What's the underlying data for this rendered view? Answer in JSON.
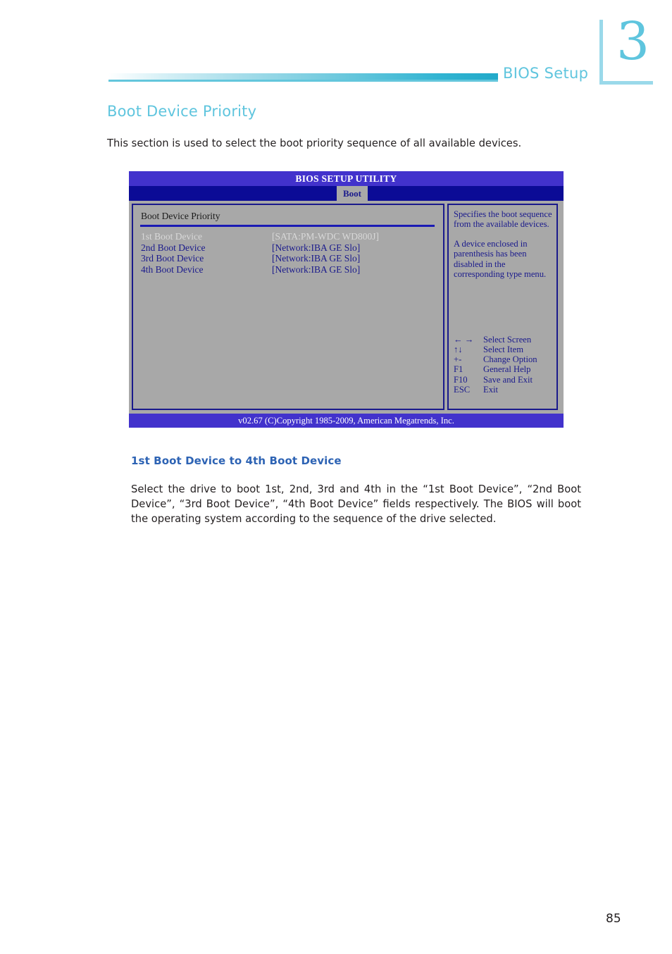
{
  "header": {
    "chapter_number": "3",
    "label": "BIOS Setup"
  },
  "section": {
    "heading": "Boot Device Priority",
    "intro": "This section is used to select the boot priority sequence of all available devices."
  },
  "bios": {
    "title": "BIOS SETUP UTILITY",
    "active_tab": "Boot",
    "panel_title": "Boot Device Priority",
    "devices": [
      {
        "label": "1st Boot Device",
        "value": "[SATA:PM-WDC WD800J]",
        "selected": true
      },
      {
        "label": "2nd Boot Device",
        "value": "[Network:IBA GE Slo]",
        "selected": false
      },
      {
        "label": "3rd Boot Device",
        "value": "[Network:IBA GE Slo]",
        "selected": false
      },
      {
        "label": "4th Boot Device",
        "value": "[Network:IBA GE Slo]",
        "selected": false
      }
    ],
    "help": {
      "paragraph1": "Specifies the boot sequence from the available devices.",
      "paragraph2": "A device enclosed in parenthesis has been disabled in the corresponding type menu."
    },
    "keys": [
      {
        "key": "← →",
        "desc": "Select Screen"
      },
      {
        "key": "↑↓",
        "desc": "Select Item"
      },
      {
        "key": "+-",
        "desc": "Change Option"
      },
      {
        "key": "F1",
        "desc": "General Help"
      },
      {
        "key": "F10",
        "desc": "Save and Exit"
      },
      {
        "key": "ESC",
        "desc": "Exit"
      }
    ],
    "footer": "v02.67 (C)Copyright 1985-2009, American Megatrends, Inc."
  },
  "subsection": {
    "heading": "1st Boot Device to 4th Boot Device",
    "body": "Select the drive to boot 1st, 2nd, 3rd and 4th in the “1st Boot Device”, “2nd Boot Device”, “3rd Boot Device”, “4th Boot Device” fields respectively. The BIOS will boot the operating system according to the sequence of the drive selected."
  },
  "page_number": "85",
  "colors": {
    "accent_teal": "#5fc5de",
    "bios_title_bar": "#4232cc",
    "bios_menu_bar": "#0b0b96",
    "bios_panel_bg": "#a8a8a8",
    "bios_text_blue": "#1a1a8c",
    "subheading_blue": "#2d63b4"
  }
}
